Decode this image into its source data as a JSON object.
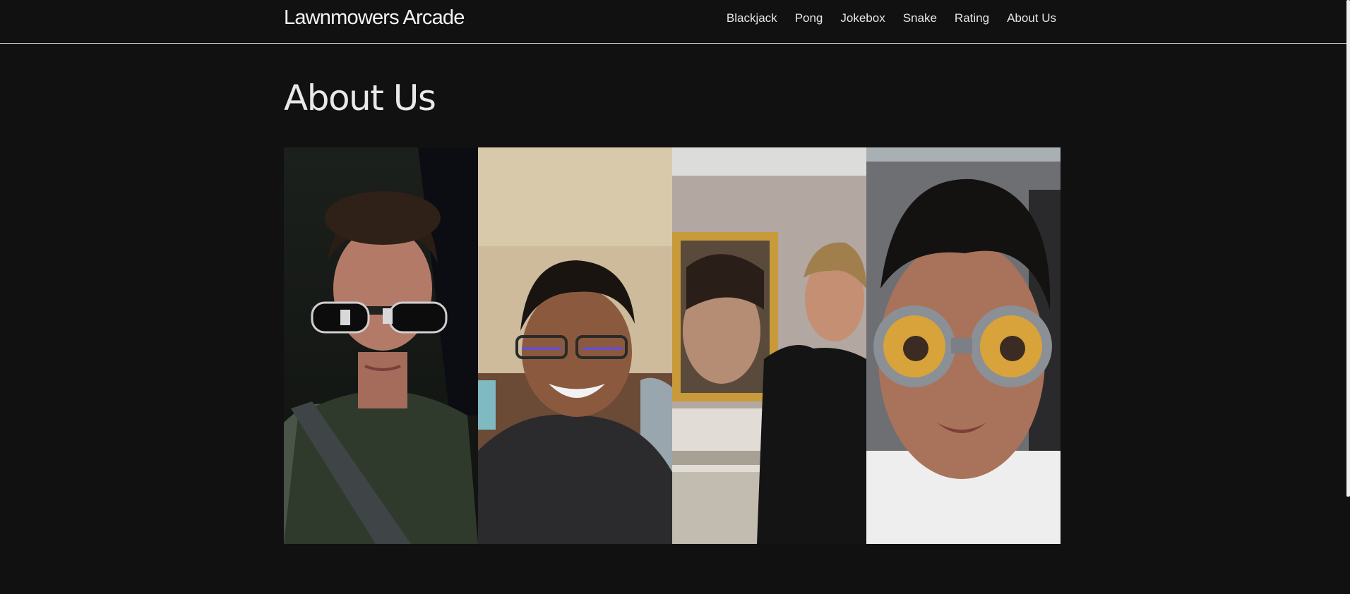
{
  "header": {
    "brand": "Lawnmowers Arcade",
    "nav": [
      "Blackjack",
      "Pong",
      "Jokebox",
      "Snake",
      "Rating",
      "About Us"
    ]
  },
  "main": {
    "title": "About Us",
    "photos": [
      {
        "name": "member-photo-1"
      },
      {
        "name": "member-photo-2"
      },
      {
        "name": "member-photo-3"
      },
      {
        "name": "member-photo-4"
      }
    ]
  },
  "colors": {
    "background": "#111111",
    "text": "#e9e9e9",
    "divider": "#c8c8c8"
  }
}
